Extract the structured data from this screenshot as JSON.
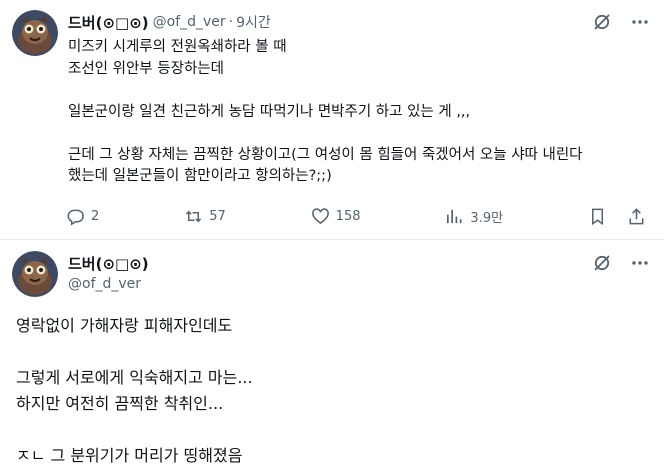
{
  "tweet1": {
    "display_name": "드버(⊙□⊙)",
    "handle": "@of_d_ver",
    "separator": "·",
    "time": "9시간",
    "text_lines": [
      "미즈키 시게루의 전원옥쇄하라 볼 때",
      "조선인 위안부 등장하는데",
      "",
      "일본군이랑 일견 친근하게 농담 따먹기나 면박주기 하고 있는 게 ,,,",
      "",
      "근데 그 상황 자체는 끔찍한 상황이고(그 여성이 몸 힘들어 죽겠어서 오늘 샤따 내린다",
      "했는데 일본군들이 함만이라고 항의하는?;;)"
    ],
    "stats": {
      "replies": "2",
      "reposts": "57",
      "likes": "158",
      "views": "3.9만"
    }
  },
  "tweet2": {
    "display_name": "드버(⊙□⊙)",
    "handle": "@of_d_ver",
    "text_lines": [
      "영락없이 가해자랑 피해자인데도",
      "",
      "그렇게 서로에게 익숙해지고 마는...",
      "하지만 여전히 끔찍한 착취인...",
      "",
      "ㅈㄴ 그 분위기가 머리가 띵해졌음"
    ]
  },
  "icons": {
    "grok": "grok-icon",
    "more": "more-icon",
    "reply": "reply-icon",
    "repost": "repost-icon",
    "like": "heart-icon",
    "views": "views-icon",
    "bookmark": "bookmark-icon",
    "share": "share-icon"
  },
  "colors": {
    "text": "#0f1419",
    "secondary": "#536471",
    "divider": "#e7e9ea"
  }
}
